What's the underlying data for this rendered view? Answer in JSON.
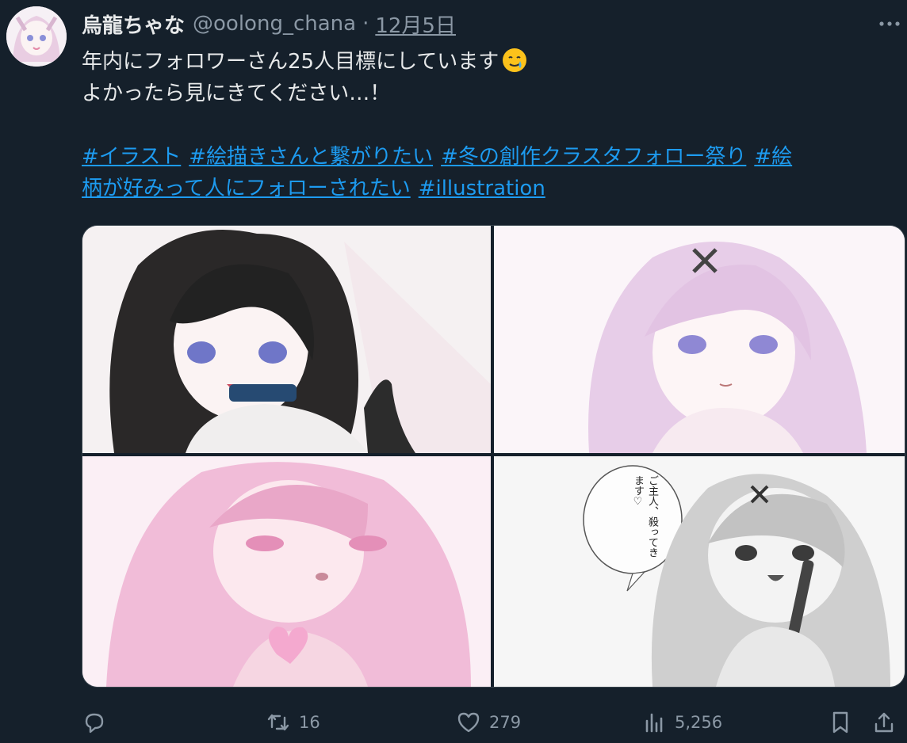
{
  "author": {
    "name": "烏龍ちゃな",
    "handle": "@oolong_chana",
    "separator": "·",
    "date": "12月5日"
  },
  "tweet": {
    "line1": "年内にフォロワーさん25人目標にしています",
    "emoji": "smiling-face-with-tear-icon",
    "line2": "よかったら見にきてください…！",
    "hashtags": [
      "#イラスト",
      "#絵描きさんと繋がりたい",
      "#冬の創作クラスタフォロー祭り",
      "#絵",
      "柄が好みって人にフォローされたい",
      "#illustration"
    ]
  },
  "media": {
    "speech_bubble": "ご主人、殺ってきます♡"
  },
  "actions": {
    "reply_count": "",
    "retweet_count": "16",
    "like_count": "279",
    "views_count": "5,256"
  },
  "colors": {
    "background": "#15202b",
    "text": "#e7e9ea",
    "secondary": "#8b98a5",
    "link": "#1d9bf0"
  }
}
